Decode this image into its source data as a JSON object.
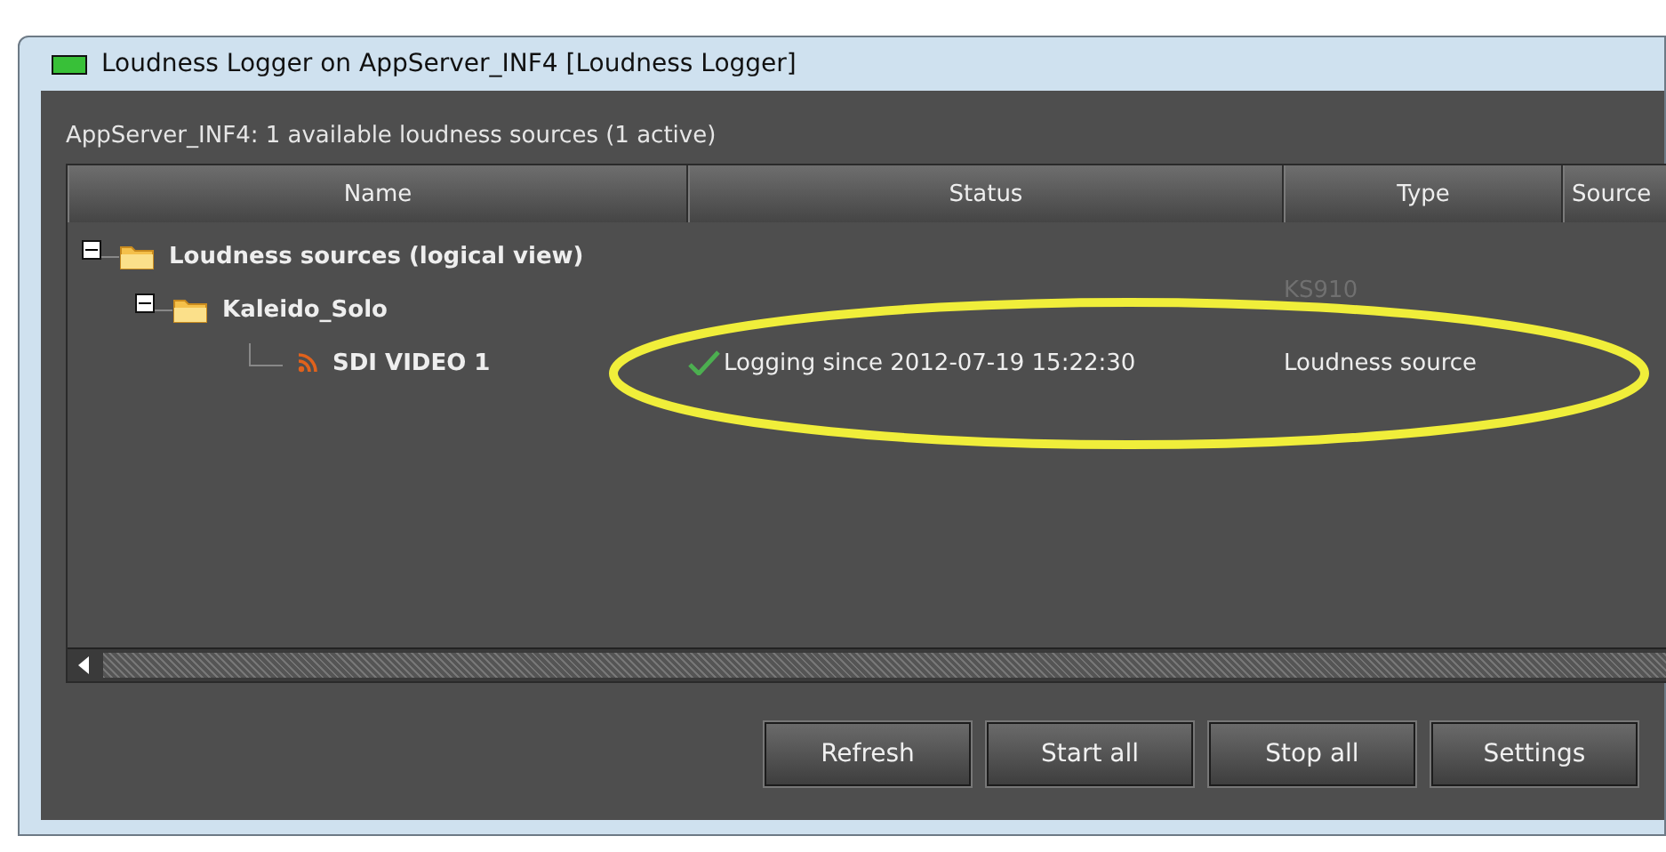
{
  "window": {
    "title": "Loudness Logger on AppServer_INF4 [Loudness Logger]"
  },
  "summary": "AppServer_INF4: 1 available loudness sources (1 active)",
  "table": {
    "columns": [
      "Name",
      "Status",
      "Type",
      "Source"
    ],
    "tree": [
      {
        "kind": "folder",
        "name": "Loudness sources (logical view)",
        "expanded": true,
        "children": [
          {
            "kind": "folder",
            "name": "Kaleido_Solo",
            "type": "KS910",
            "expanded": true,
            "children": [
              {
                "kind": "source",
                "name": "SDI VIDEO 1",
                "status": "Logging since 2012-07-19 15:22:30",
                "type": "Loudness source"
              }
            ]
          }
        ]
      }
    ]
  },
  "buttons": [
    "Refresh",
    "Start all",
    "Stop all",
    "Settings"
  ]
}
